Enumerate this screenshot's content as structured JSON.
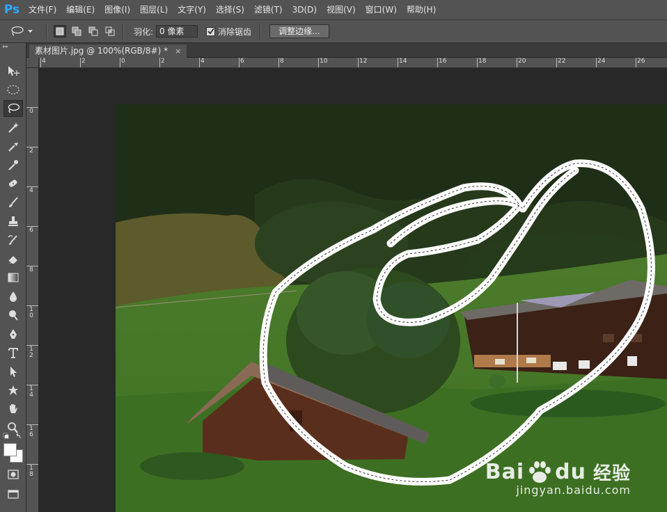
{
  "app": {
    "logo": "Ps"
  },
  "menu": [
    "文件(F)",
    "编辑(E)",
    "图像(I)",
    "图层(L)",
    "文字(Y)",
    "选择(S)",
    "滤镜(T)",
    "3D(D)",
    "视图(V)",
    "窗口(W)",
    "帮助(H)"
  ],
  "options": {
    "feather_label": "羽化:",
    "feather_value": "0 像素",
    "antialias_label": "消除锯齿",
    "antialias_checked": true,
    "refine_button": "调整边缘..."
  },
  "document": {
    "tab_title": "素材图片.jpg @ 100%(RGB/8#) *",
    "close_glyph": "×"
  },
  "rulers": {
    "horizontal": [
      "4",
      "2",
      "0",
      "2",
      "4",
      "6",
      "8",
      "10",
      "12",
      "14",
      "16",
      "18",
      "20",
      "22",
      "24",
      "26"
    ],
    "vertical": [
      "0",
      "2",
      "4",
      "6",
      "8",
      "10",
      "12",
      "14",
      "16",
      "18"
    ]
  },
  "watermark": {
    "brand": "Bai",
    "brand2": "du",
    "cn": "经验",
    "url": "jingyan.baidu.com"
  },
  "tools": [
    "move-icon",
    "marquee-ellipse-icon",
    "lasso-icon",
    "magic-wand-icon",
    "eyedropper-icon",
    "brush-small-icon",
    "healing-icon",
    "brush-icon",
    "stamp-icon",
    "history-brush-icon",
    "eraser-icon",
    "gradient-icon",
    "blur-icon",
    "dodge-icon",
    "pen-icon",
    "type-icon",
    "path-select-icon",
    "shape-icon",
    "hand-icon",
    "zoom-icon"
  ],
  "colors": {
    "accent": "#31a8ff",
    "panel": "#535353",
    "canvas_bg": "#282828"
  }
}
